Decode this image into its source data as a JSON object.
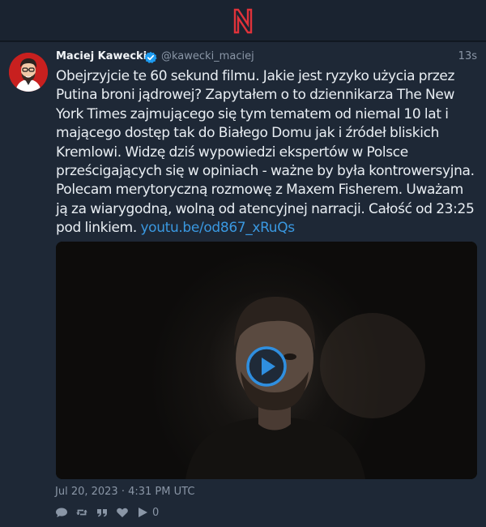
{
  "header": {
    "logo_letter": "N",
    "logo_color": "#e0323a"
  },
  "tweet": {
    "fullname": "Maciej Kawecki",
    "username": "@kawecki_maciej",
    "time_ago": "13s",
    "verified": true,
    "text": "Obejrzyjcie te 60 sekund filmu. Jakie jest ryzyko użycia przez Putina broni jądrowej? Zapytałem o to dziennikarza The New York Times zajmującego się tym tematem od niemal 10 lat i mającego dostęp tak do Białego Domu jak i źródeł bliskich Kremlowi. Widzę dziś wypowiedzi ekspertów w Polsce prześcigających się w opiniach - ważne by była kontrowersyjna. Polecam merytoryczną rozmowę z Maxem Fisherem. Uważam ją za wiarygodną, wolną od atencyjnej narracji. Całość od 23:25 pod linkiem. ",
    "link": "youtu.be/od867_xRuQs",
    "date": "Jul 20, 2023 · 4:31 PM UTC",
    "play_count": "0",
    "link_color": "#3a98e0",
    "verified_color": "#1d9bf0"
  },
  "icons": {
    "reply": "comment-icon",
    "retweet": "retweet-icon",
    "quote": "quote-icon",
    "like": "heart-icon",
    "plays": "play-icon"
  }
}
